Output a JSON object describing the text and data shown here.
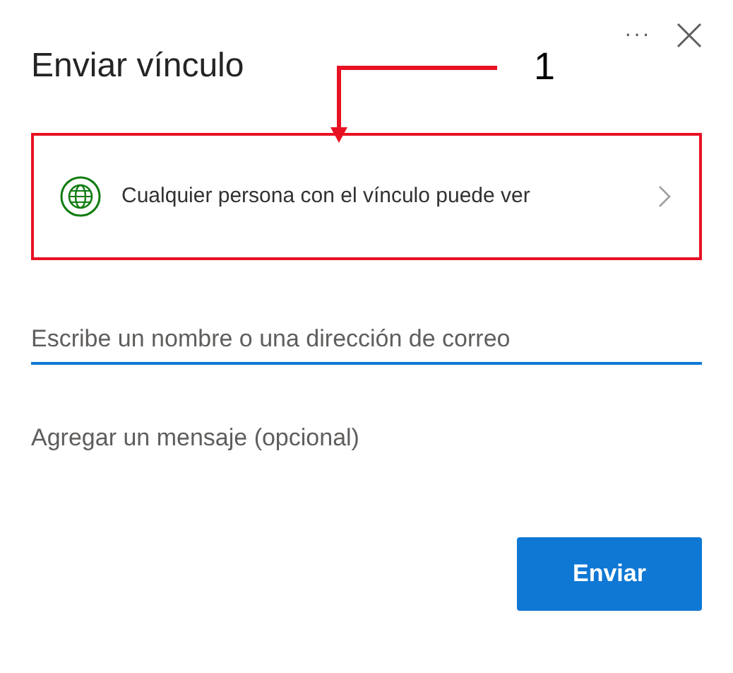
{
  "dialog": {
    "title": "Enviar vínculo",
    "more_menu": "···"
  },
  "link_setting": {
    "text": "Cualquier persona con el vínculo puede ver"
  },
  "annotation": {
    "label": "1"
  },
  "recipient_field": {
    "placeholder": "Escribe un nombre o una dirección de correo"
  },
  "message_field": {
    "placeholder": "Agregar un mensaje (opcional)"
  },
  "buttons": [
    {
      "label": "Enviar",
      "kind": "primary"
    }
  ]
}
